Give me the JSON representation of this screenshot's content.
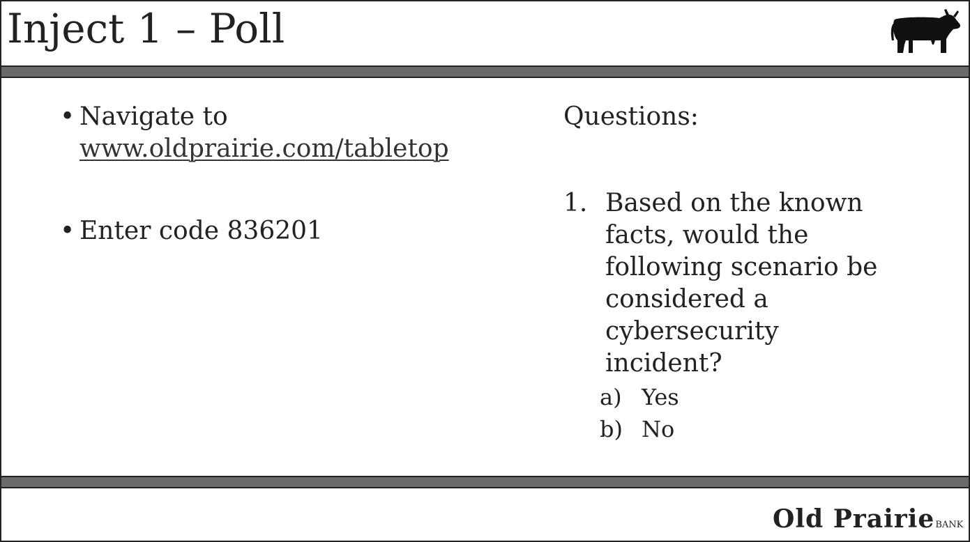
{
  "slide": {
    "title": "Inject 1 – Poll",
    "logo_icon": "cow-icon",
    "colors": {
      "bar": "#6b6b6b",
      "text": "#222222",
      "background": "#ffffff"
    }
  },
  "instructions": {
    "navigate_label": "Navigate to",
    "url": "www.oldprairie.com/tabletop",
    "code_label": "Enter code 836201"
  },
  "questions": {
    "heading": "Questions:",
    "items": [
      {
        "number": "1.",
        "text": "Based on the known facts, would the following scenario be considered a cybersecurity incident?",
        "options": [
          {
            "letter": "a)",
            "text": "Yes"
          },
          {
            "letter": "b)",
            "text": "No"
          }
        ]
      }
    ]
  },
  "footer": {
    "brand_name": "Old Prairie",
    "brand_suffix": "BANK"
  }
}
